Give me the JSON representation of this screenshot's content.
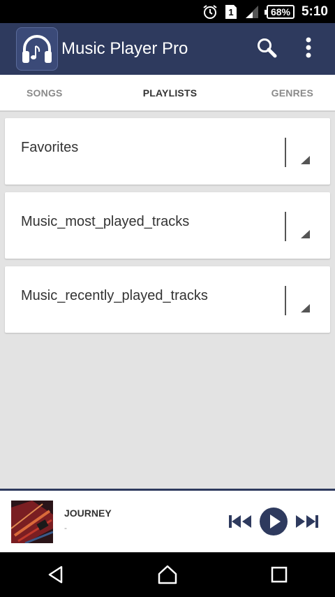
{
  "status_bar": {
    "sim_label": "1",
    "battery": "68%",
    "time": "5:10"
  },
  "app_bar": {
    "title": "Music Player Pro"
  },
  "tabs": [
    {
      "label": "SONGS",
      "active": false
    },
    {
      "label": "PLAYLISTS",
      "active": true
    },
    {
      "label": "GENRES",
      "active": false
    }
  ],
  "playlists": [
    {
      "name": "Favorites"
    },
    {
      "name": "Music_most_played_tracks"
    },
    {
      "name": "Music_recently_played_tracks"
    }
  ],
  "now_playing": {
    "title": "JOURNEY",
    "subtitle": "-"
  },
  "colors": {
    "app_bar": "#2e3a5e",
    "accent": "#2e3a5e",
    "background": "#e3e3e3"
  }
}
